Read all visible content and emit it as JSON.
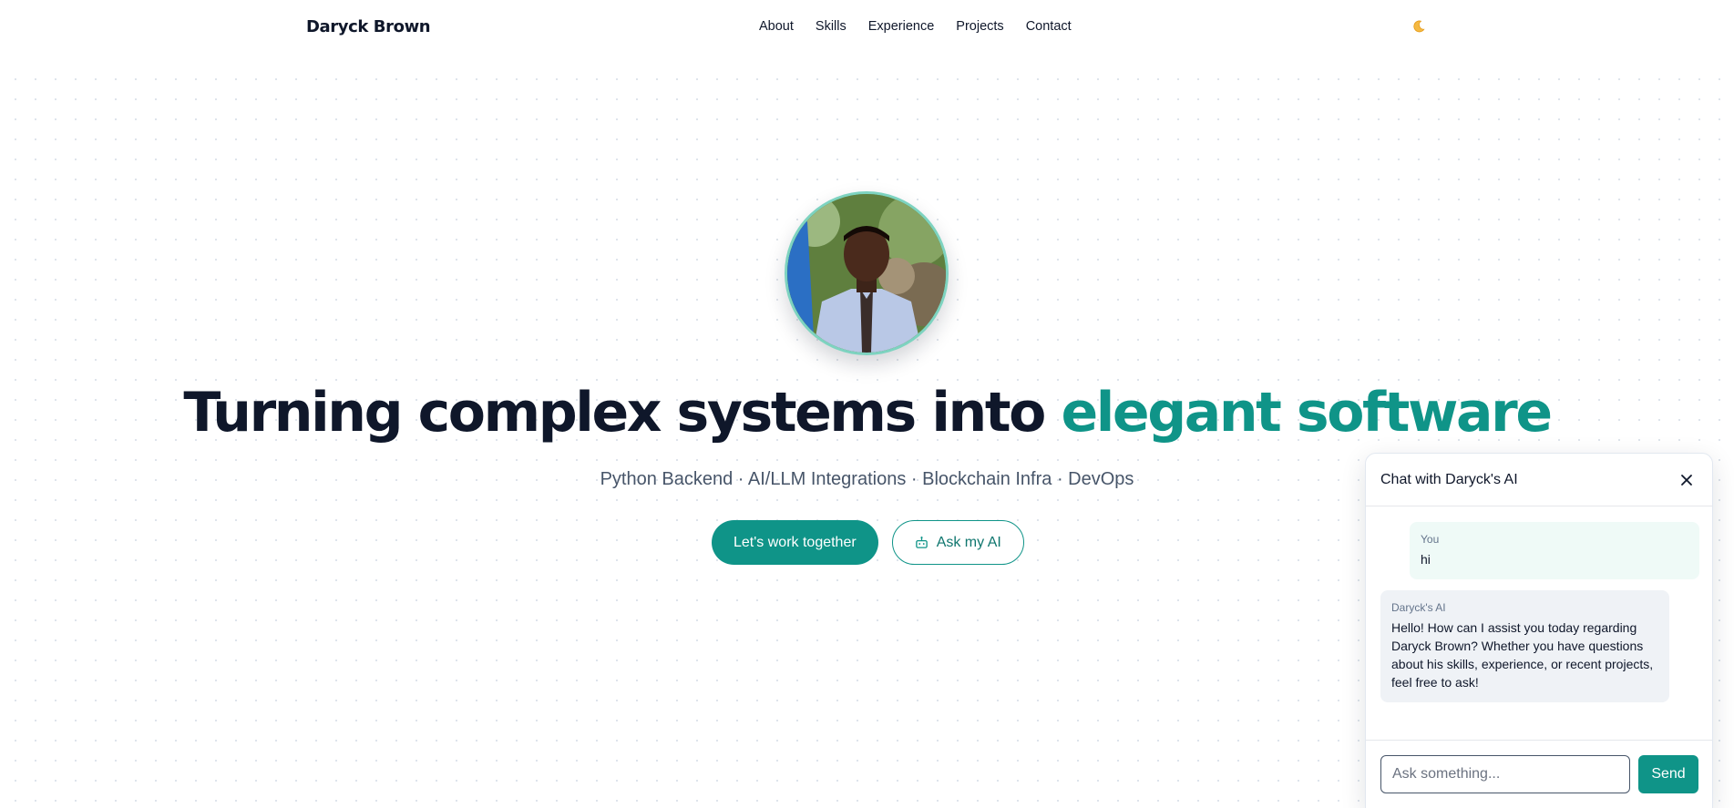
{
  "nav": {
    "brand": "Daryck Brown",
    "links": [
      "About",
      "Skills",
      "Experience",
      "Projects",
      "Contact"
    ],
    "theme_icon": "moon-icon"
  },
  "hero": {
    "headline_main": "Turning complex systems into ",
    "headline_accent": "elegant software",
    "subtitle": "Python Backend · AI/LLM Integrations · Blockchain Infra · DevOps",
    "primary_cta": "Let's work together",
    "secondary_cta": "Ask my AI",
    "secondary_cta_icon": "robot-icon"
  },
  "chat": {
    "title": "Chat with Daryck's AI",
    "close_icon": "close-icon",
    "messages": [
      {
        "sender": "You",
        "text": "hi"
      },
      {
        "sender": "Daryck's AI",
        "text": "Hello! How can I assist you today regarding Daryck Brown? Whether you have questions about his skills, experience, or recent projects, feel free to ask!"
      }
    ],
    "input_placeholder": "Ask something...",
    "send_label": "Send"
  },
  "colors": {
    "accent": "#0f9488",
    "text": "#0f172a",
    "muted": "#475569",
    "user_bubble": "#effaf7",
    "ai_bubble": "#eff2f6"
  }
}
